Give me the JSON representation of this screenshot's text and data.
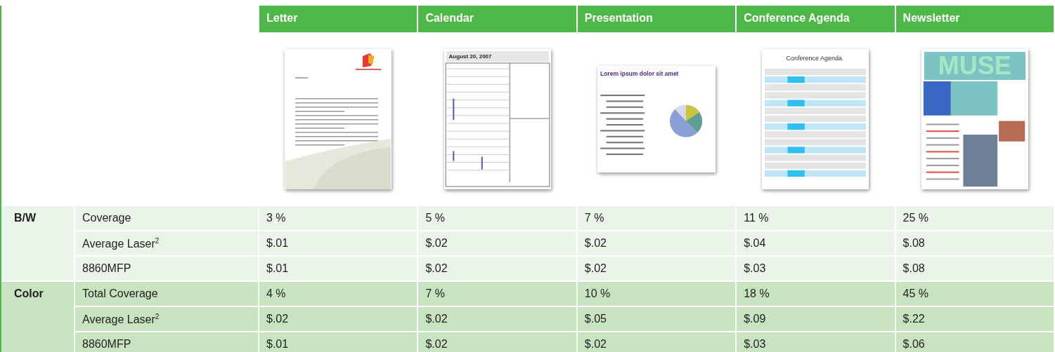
{
  "table": {
    "columns": [
      {
        "label": "Letter",
        "kind": "letter"
      },
      {
        "label": "Calendar",
        "kind": "calendar",
        "heading": "August 20, 2007"
      },
      {
        "label": "Presentation",
        "kind": "presentation",
        "heading": "Lorem ipsum dolor sit amet"
      },
      {
        "label": "Conference Agenda",
        "kind": "agenda",
        "heading": "Conference Agenda"
      },
      {
        "label": "Newsletter",
        "kind": "newsletter",
        "heading": "MUSE"
      }
    ],
    "groups": [
      {
        "label": "B/W",
        "color": "#eaf4e8",
        "rows": [
          {
            "label": "Coverage",
            "values": [
              "3 %",
              "5 %",
              "7 %",
              "11 %",
              "25 %"
            ]
          },
          {
            "label": "Average Laser$^{2}$",
            "values": [
              "$.01",
              "$.02",
              "$.02",
              "$.04",
              "$.08"
            ]
          },
          {
            "label": "8860MFP",
            "values": [
              "$.01",
              "$.02",
              "$.02",
              "$.03",
              "$.08"
            ]
          }
        ]
      },
      {
        "label": "Color",
        "color": "#c8e3c0",
        "rows": [
          {
            "label": "Total Coverage",
            "values": [
              "4 %",
              "7 %",
              "10 %",
              "18 %",
              "45 %"
            ]
          },
          {
            "label": "Average Laser$^{2}$",
            "values": [
              "$.02",
              "$.02",
              "$.05",
              "$.09",
              "$.22"
            ]
          },
          {
            "label": "8860MFP",
            "values": [
              "$.01",
              "$.02",
              "$.02",
              "$.03",
              "$.06"
            ]
          }
        ]
      }
    ]
  }
}
